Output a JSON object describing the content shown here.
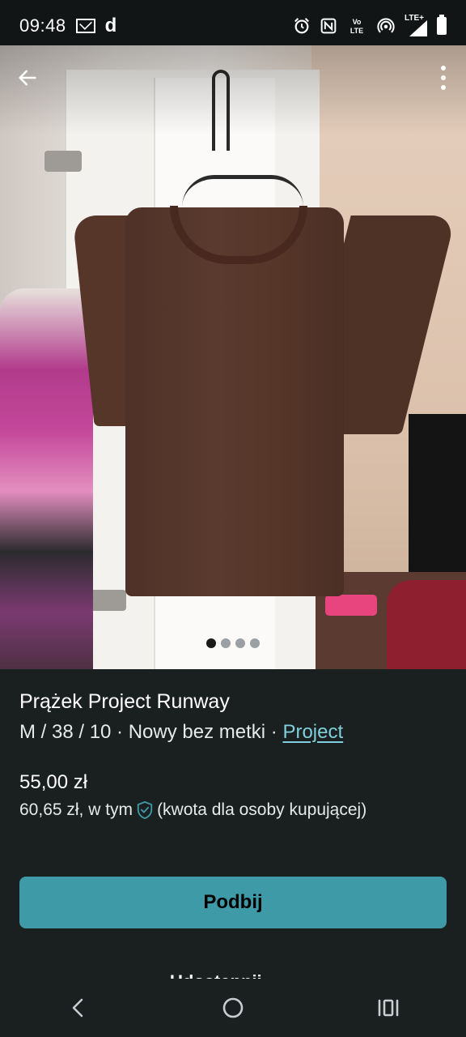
{
  "status_bar": {
    "time": "09:48",
    "left_icons": [
      "mail-icon",
      "d-app-icon"
    ],
    "right_icons": [
      "alarm-icon",
      "nfc-icon",
      "volte-icon",
      "hotspot-icon",
      "lte-signal-icon",
      "battery-icon"
    ],
    "volte_label": "Vo\nLTE",
    "lte_label": "LTE+"
  },
  "photo": {
    "carousel_count": 4,
    "carousel_active": 0
  },
  "item": {
    "title": "Prążek Project Runway",
    "size_condition": "M / 38 / 10 · Nowy bez metki · ",
    "brand_link": "Project",
    "price": "55,00 zł",
    "total_price": "60,65 zł, w tym",
    "total_price_note": "(kwota dla osoby kupującej)"
  },
  "actions": {
    "boost_button": "Podbij",
    "partial_next": "Udostępnij"
  },
  "colors": {
    "background": "#1a1f20",
    "accent": "#3e9aa6",
    "link": "#7fd0dc"
  }
}
